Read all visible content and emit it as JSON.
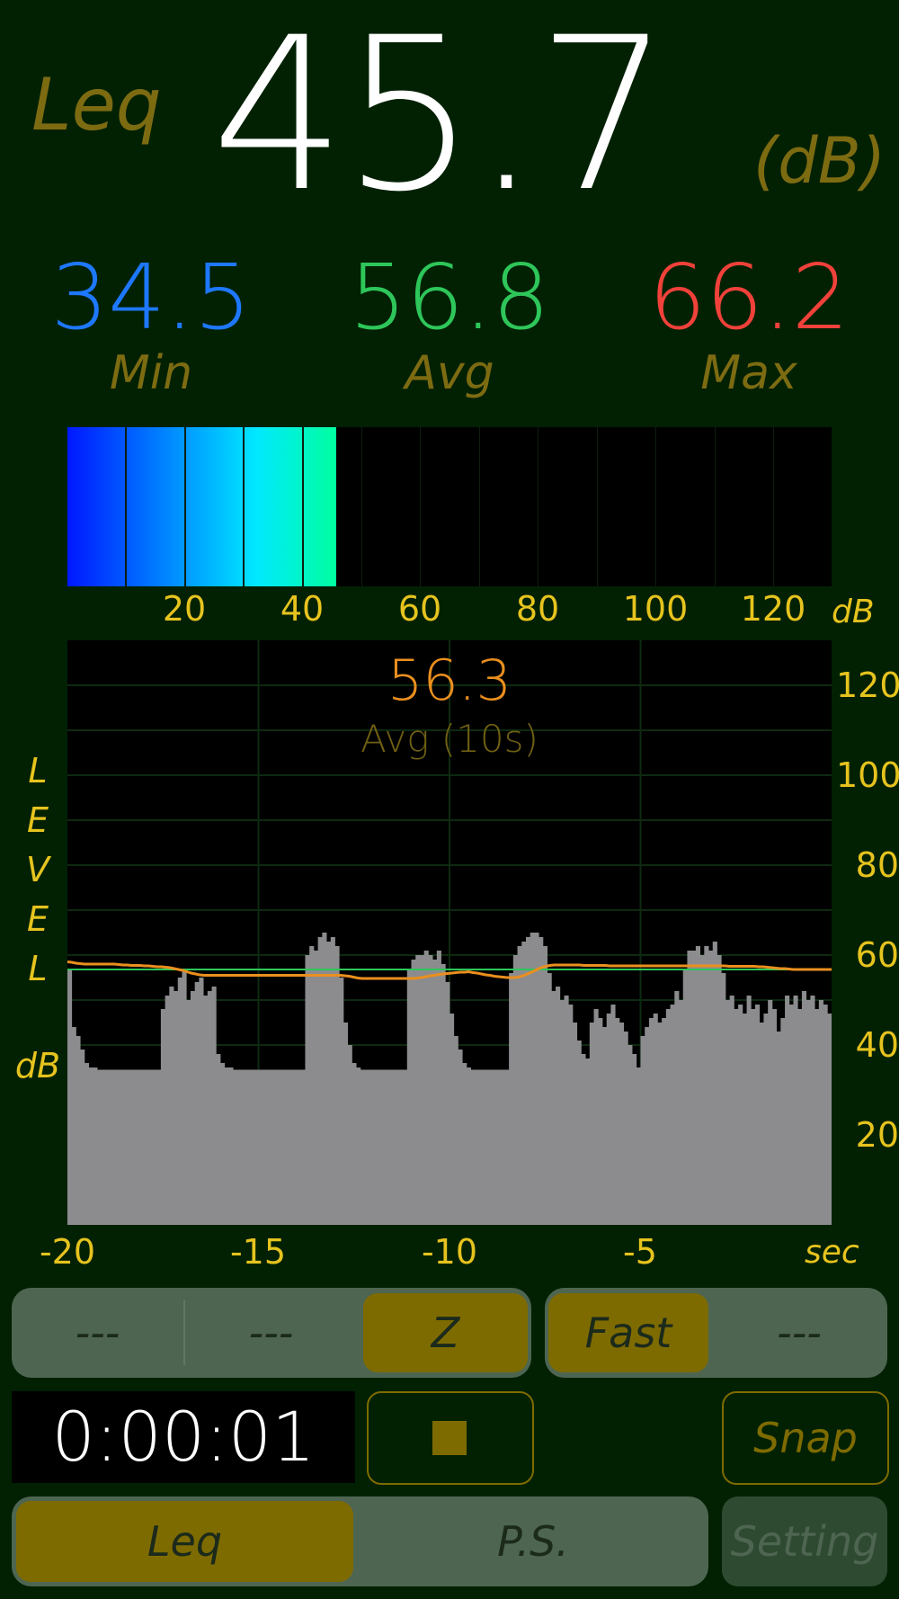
{
  "header": {
    "mode_label": "Leq",
    "value": "45.7",
    "unit": "(dB)"
  },
  "stats": {
    "min_value": "34.5",
    "min_label": "Min",
    "avg_value": "56.8",
    "avg_label": "Avg",
    "max_value": "66.2",
    "max_label": "Max",
    "min_color": "#1e78ff",
    "avg_color": "#2ec65a",
    "max_color": "#f0413a"
  },
  "level_bar": {
    "current_db": 45.7,
    "scale_labels": [
      "20",
      "40",
      "60",
      "80",
      "100",
      "120"
    ],
    "unit": "dB"
  },
  "graph": {
    "avg_value": "56.3",
    "avg_label": "Avg (10s)",
    "left_letters": [
      "L",
      "E",
      "V",
      "E",
      "L"
    ],
    "left_unit": "dB",
    "y_ticks": [
      "120",
      "100",
      "80",
      "60",
      "40",
      "20"
    ],
    "x_ticks": [
      "-20",
      "-15",
      "-10",
      "-5"
    ],
    "x_unit": "sec",
    "avg_line_db": 56.8,
    "levels_db": [
      57,
      44,
      42,
      39,
      36,
      35,
      35,
      34.5,
      34.5,
      34.5,
      34.5,
      34.5,
      34.5,
      34.5,
      34.5,
      34.5,
      34.5,
      34.5,
      34.5,
      34.5,
      34.5,
      34.5,
      48,
      51,
      53,
      52,
      55,
      57,
      50,
      52,
      54,
      55,
      51,
      52,
      53,
      38,
      36,
      35,
      35,
      34.5,
      34.5,
      34.5,
      34.5,
      34.5,
      34.5,
      34.5,
      34.5,
      34.5,
      34.5,
      34.5,
      34.5,
      34.5,
      34.5,
      34.5,
      34.5,
      34.5,
      60,
      62,
      61,
      64,
      65,
      63,
      64,
      62,
      55,
      45,
      40,
      36,
      35,
      34.5,
      34.5,
      34.5,
      34.5,
      34.5,
      34.5,
      34.5,
      34.5,
      34.5,
      34.5,
      34.5,
      57,
      59,
      60,
      60,
      61,
      60,
      59,
      61,
      58,
      54,
      47,
      42,
      39,
      36,
      35,
      34.5,
      34.5,
      34.5,
      34.5,
      34.5,
      34.5,
      34.5,
      34.5,
      34.5,
      56,
      60,
      62,
      63,
      64,
      65,
      65,
      64,
      62,
      56,
      52,
      53,
      50,
      51,
      49,
      45,
      41,
      38,
      37,
      45,
      48,
      46,
      44,
      47,
      49,
      46,
      45,
      43,
      40,
      38,
      35,
      42,
      44,
      46,
      47,
      45,
      46,
      48,
      49,
      52,
      50,
      57,
      61,
      61,
      62,
      60,
      62,
      61,
      63,
      60,
      56,
      50,
      51,
      48,
      49,
      47,
      51,
      48,
      49,
      45,
      47,
      50,
      48,
      43,
      46,
      51,
      49,
      51,
      48,
      52,
      50,
      51,
      48,
      50,
      49,
      47
    ],
    "leq_trend_db": [
      58.5,
      58.4,
      58.2,
      58.1,
      58,
      58,
      58,
      58,
      58,
      58,
      58,
      58,
      57.9,
      57.8,
      57.8,
      57.7,
      57.7,
      57.7,
      57.6,
      57.6,
      57.5,
      57.4,
      57.4,
      57.3,
      57.2,
      57,
      56.8,
      56.6,
      56.3,
      56,
      55.8,
      55.6,
      55.5,
      55.5,
      55.5,
      55.5,
      55.5,
      55.5,
      55.5,
      55.5,
      55.5,
      55.5,
      55.5,
      55.5,
      55.5,
      55.5,
      55.5,
      55.5,
      55.5,
      55.5,
      55.5,
      55.5,
      55.5,
      55.5,
      55.5,
      55.5,
      55.5,
      55.5,
      55.5,
      55.5,
      55.5,
      55.5,
      55.5,
      55.5,
      55.5,
      55.4,
      55.3,
      55.1,
      54.9,
      54.8,
      54.8,
      54.8,
      54.8,
      54.8,
      54.8,
      54.8,
      54.8,
      54.8,
      54.8,
      54.8,
      54.8,
      54.8,
      54.9,
      55,
      55.2,
      55.4,
      55.5,
      55.7,
      55.8,
      55.9,
      56,
      56.1,
      56.2,
      56.2,
      56.3,
      56.1,
      56,
      55.8,
      55.6,
      55.5,
      55.3,
      55.2,
      55.1,
      55,
      55,
      55,
      55.2,
      55.5,
      55.9,
      56.3,
      56.8,
      57.2,
      57.5,
      57.7,
      57.8,
      57.8,
      57.8,
      57.8,
      57.8,
      57.8,
      57.8,
      57.7,
      57.7,
      57.7,
      57.7,
      57.7,
      57.7,
      57.6,
      57.6,
      57.6,
      57.6,
      57.6,
      57.6,
      57.6,
      57.6,
      57.6,
      57.6,
      57.6,
      57.6,
      57.6,
      57.6,
      57.6,
      57.6,
      57.6,
      57.6,
      57.6,
      57.6,
      57.6,
      57.6,
      57.6,
      57.6,
      57.6,
      57.6,
      57.6,
      57.6,
      57.5,
      57.5,
      57.5,
      57.5,
      57.5,
      57.5,
      57.5,
      57.4,
      57.4,
      57.3,
      57.2,
      57.1,
      57,
      57,
      56.9,
      56.8,
      56.8,
      56.8,
      56.8,
      56.8,
      56.8,
      56.8,
      56.8,
      56.8,
      56.8
    ]
  },
  "controls": {
    "weighting": [
      "---",
      "---",
      "Z"
    ],
    "weighting_selected": 2,
    "response": [
      "Fast",
      "---"
    ],
    "response_selected": 0,
    "timer": "0:00:01",
    "snap_label": "Snap",
    "tabs": [
      "Leq",
      "P.S."
    ],
    "tab_selected": 0,
    "setting_label": "Setting"
  }
}
